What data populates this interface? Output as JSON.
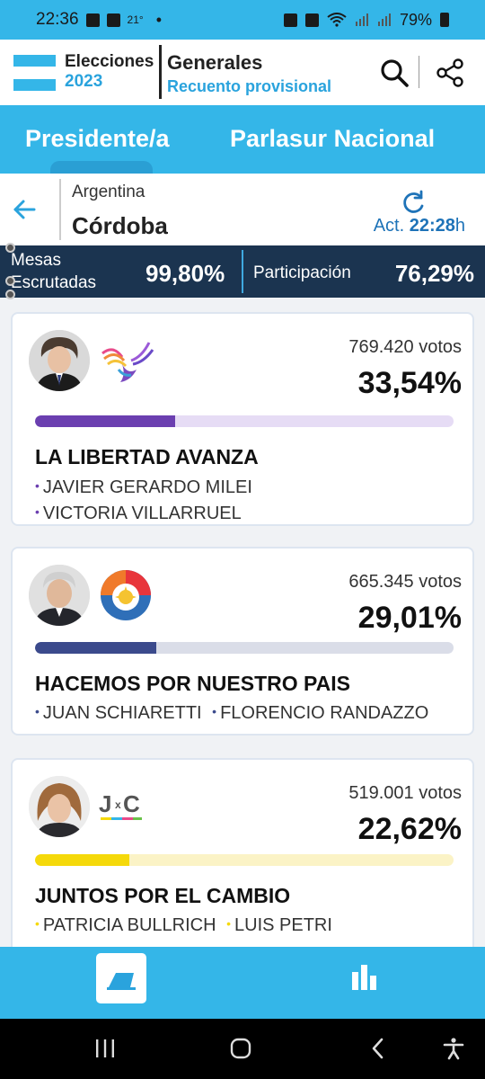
{
  "status_bar": {
    "time": "22:36",
    "temperature": "21°",
    "dot": "•",
    "battery": "79%"
  },
  "header": {
    "logo_line1": "Elecciones",
    "logo_line2": "2023",
    "title": "Generales",
    "subtitle": "Recuento provisional",
    "icons": [
      "search-icon",
      "share-icon"
    ]
  },
  "tabs": [
    {
      "label": "Presidente/a",
      "active": true
    },
    {
      "label": "Parlasur Nacional",
      "active": false
    }
  ],
  "location": {
    "country": "Argentina",
    "province": "Córdoba",
    "act_label": "Act.",
    "act_time": "22:28",
    "act_unit": "h"
  },
  "stats": {
    "mesas_label_1": "Mesas",
    "mesas_label_2": "Escrutadas",
    "mesas_value": "99,80%",
    "participacion_label": "Participación",
    "participacion_value": "76,29%"
  },
  "results": [
    {
      "votes": "769.420 votos",
      "percent": "33,54%",
      "share": 33.54,
      "color": "#6b3fb0",
      "track": "#e6dcf5",
      "bullet_color": "#6b3fb0",
      "party": "LA LIBERTAD AVANZA",
      "candidates": [
        "JAVIER GERARDO MILEI",
        "VICTORIA VILLARRUEL"
      ]
    },
    {
      "votes": "665.345 votos",
      "percent": "29,01%",
      "share": 29.01,
      "color": "#3b4a8c",
      "track": "#dadde8",
      "bullet_color": "#3b4a8c",
      "party": "HACEMOS POR NUESTRO PAIS",
      "candidates": [
        "JUAN SCHIARETTI",
        "FLORENCIO RANDAZZO"
      ]
    },
    {
      "votes": "519.001 votos",
      "percent": "22,62%",
      "share": 22.62,
      "color": "#f5d90a",
      "track": "#fbf3c6",
      "bullet_color": "#f5d90a",
      "party": "JUNTOS POR EL CAMBIO",
      "candidates": [
        "PATRICIA BULLRICH",
        "LUIS PETRI"
      ]
    }
  ],
  "bottom_nav": {
    "items": [
      "ballot-icon",
      "bar-chart-icon"
    ]
  },
  "colors": {
    "brand_blue": "#34b6e8",
    "dark_bar": "#1b3450",
    "accent_text": "#2aa3dd"
  }
}
